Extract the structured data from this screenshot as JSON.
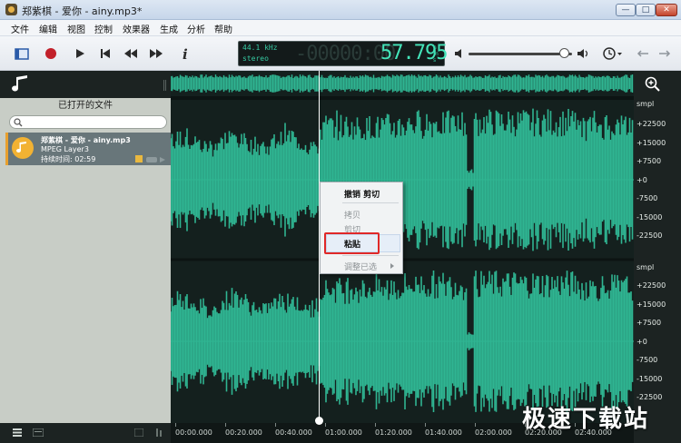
{
  "window": {
    "title": "郑紫棋 - 爱你 - ainy.mp3*"
  },
  "menu": [
    {
      "label": "文件"
    },
    {
      "label": "编辑"
    },
    {
      "label": "视图"
    },
    {
      "label": "控制"
    },
    {
      "label": "效果器"
    },
    {
      "label": "生成"
    },
    {
      "label": "分析"
    },
    {
      "label": "帮助"
    }
  ],
  "toolbar": {
    "buttons": [
      {
        "icon": "panel-toggle-icon"
      },
      {
        "icon": "record-icon"
      },
      {
        "icon": "play-icon"
      },
      {
        "icon": "skip-to-start-icon"
      },
      {
        "icon": "rewind-icon"
      },
      {
        "icon": "fast-forward-icon"
      },
      {
        "icon": "info-icon"
      }
    ],
    "display": {
      "sample_rate": "44.1 kHz",
      "channels": "stereo",
      "ghost_digits": "-00000:00",
      "time": "57.795",
      "units": "h m s"
    },
    "volume_level": 0.93,
    "right_icons": [
      "volume-icon",
      "speaker-icon",
      "clock-icon",
      "undo-arrow-icon",
      "redo-arrow-icon"
    ]
  },
  "files_panel": {
    "title": "已打开的文件",
    "search_placeholder": "",
    "files": [
      {
        "name": "郑紫棋 - 爱你 - ainy.mp3",
        "format": "MPEG Layer3",
        "duration": "持续时间: 02:59"
      }
    ]
  },
  "ruler": {
    "unit": "smpl",
    "channel1": [
      "+22500",
      "+15000",
      "+7500",
      "+0",
      "-7500",
      "-15000",
      "-22500"
    ],
    "channel2": [
      "+22500",
      "+15000",
      "+7500",
      "+0",
      "-7500",
      "-15000",
      "-22500"
    ]
  },
  "timeline": {
    "labels": [
      "00:00.000",
      "00:20.000",
      "00:40.000",
      "01:00.000",
      "01:20.000",
      "01:40.000",
      "02:00.000",
      "02:20.000",
      "02:40.000"
    ]
  },
  "context_menu": {
    "items": [
      {
        "label": "撤销 剪切",
        "enabled": true
      },
      {
        "label": "拷贝",
        "enabled": false
      },
      {
        "label": "剪切",
        "enabled": false
      },
      {
        "label": "粘贴",
        "enabled": true
      },
      {
        "label": "调整已选",
        "enabled": false
      }
    ]
  },
  "watermark": {
    "text": "极速下载站"
  },
  "colors": {
    "waveform": "#2fb592",
    "waveform_background": "#14201e",
    "highlight_box": "#e02828",
    "accent": "#e8a02e"
  }
}
